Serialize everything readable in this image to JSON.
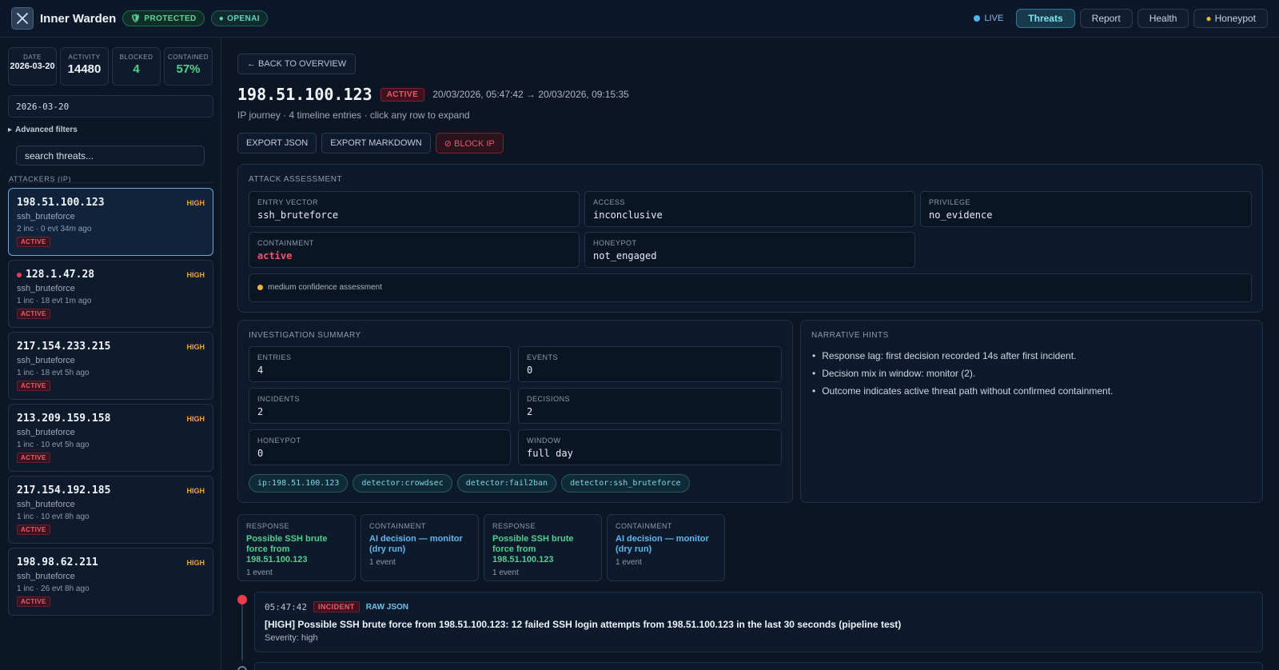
{
  "header": {
    "app_title": "Inner Warden",
    "status_pills": [
      "PROTECTED",
      "OPENAI"
    ],
    "live_label": "LIVE",
    "nav": [
      "Threats",
      "Report",
      "Health",
      "Honeypot"
    ]
  },
  "sidebar": {
    "stats": [
      {
        "label": "DATE",
        "value": "2026-03-20"
      },
      {
        "label": "ACTIVITY",
        "value": "14480"
      },
      {
        "label": "BLOCKED",
        "value": "4"
      },
      {
        "label": "CONTAINED",
        "value": "57%"
      }
    ],
    "date_value": "2026-03-20",
    "advanced_filters": "Advanced filters",
    "search_placeholder": "search threats...",
    "attackers_title": "ATTACKERS (IP)",
    "attackers": [
      {
        "ip": "198.51.100.123",
        "severity": "HIGH",
        "detector": "ssh_bruteforce",
        "meta": "2 inc · 0 evt 34m ago",
        "status": "ACTIVE"
      },
      {
        "ip": "128.1.47.28",
        "severity": "HIGH",
        "detector": "ssh_bruteforce",
        "meta": "1 inc · 18 evt 1m ago",
        "status": "ACTIVE"
      },
      {
        "ip": "217.154.233.215",
        "severity": "HIGH",
        "detector": "ssh_bruteforce",
        "meta": "1 inc · 18 evt 5h ago",
        "status": "ACTIVE"
      },
      {
        "ip": "213.209.159.158",
        "severity": "HIGH",
        "detector": "ssh_bruteforce",
        "meta": "1 inc · 10 evt 5h ago",
        "status": "ACTIVE"
      },
      {
        "ip": "217.154.192.185",
        "severity": "HIGH",
        "detector": "ssh_bruteforce",
        "meta": "1 inc · 10 evt 8h ago",
        "status": "ACTIVE"
      },
      {
        "ip": "198.98.62.211",
        "severity": "HIGH",
        "detector": "ssh_bruteforce",
        "meta": "1 inc · 26 evt 8h ago",
        "status": "ACTIVE"
      }
    ]
  },
  "main": {
    "back_label": "← BACK TO OVERVIEW",
    "ip": "198.51.100.123",
    "status": "ACTIVE",
    "time_range": "20/03/2026, 05:47:42 → 20/03/2026, 09:15:35",
    "journey": "IP journey · 4 timeline entries · click any row to expand",
    "actions": [
      "EXPORT JSON",
      "EXPORT MARKDOWN",
      "⊘ BLOCK IP"
    ],
    "assessment": {
      "title": "ATTACK ASSESSMENT",
      "fields": [
        {
          "label": "ENTRY VECTOR",
          "value": "ssh_bruteforce"
        },
        {
          "label": "ACCESS",
          "value": "inconclusive"
        },
        {
          "label": "PRIVILEGE",
          "value": "no_evidence"
        },
        {
          "label": "CONTAINMENT",
          "value": "active"
        },
        {
          "label": "HONEYPOT",
          "value": "not_engaged"
        }
      ],
      "confidence": "medium confidence assessment"
    },
    "summary": {
      "title": "INVESTIGATION SUMMARY",
      "fields": [
        {
          "label": "ENTRIES",
          "value": "4"
        },
        {
          "label": "EVENTS",
          "value": "0"
        },
        {
          "label": "INCIDENTS",
          "value": "2"
        },
        {
          "label": "DECISIONS",
          "value": "2"
        },
        {
          "label": "HONEYPOT",
          "value": "0"
        },
        {
          "label": "WINDOW",
          "value": "full day"
        }
      ],
      "tags": [
        "ip:198.51.100.123",
        "detector:crowdsec",
        "detector:fail2ban",
        "detector:ssh_bruteforce"
      ]
    },
    "hints": {
      "title": "NARRATIVE HINTS",
      "items": [
        "Response lag: first decision recorded 14s after first incident.",
        "Decision mix in window: monitor (2).",
        "Outcome indicates active threat path without confirmed containment."
      ]
    },
    "timeline_cards": [
      {
        "kind": "RESPONSE",
        "text": "Possible SSH brute force from 198.51.100.123",
        "count": "1 event"
      },
      {
        "kind": "CONTAINMENT",
        "text": "AI decision — monitor (dry run)",
        "count": "1 event"
      },
      {
        "kind": "RESPONSE",
        "text": "Possible SSH brute force from 198.51.100.123",
        "count": "1 event"
      },
      {
        "kind": "CONTAINMENT",
        "text": "AI decision — monitor (dry run)",
        "count": "1 event"
      }
    ],
    "entry": {
      "time": "05:47:42",
      "badge": "INCIDENT",
      "raw_json": "RAW JSON",
      "message": "[HIGH] Possible SSH brute force from 198.51.100.123: 12 failed SSH login attempts from 198.51.100.123 in the last 30 seconds (pipeline test)",
      "severity": "Severity: high"
    }
  }
}
